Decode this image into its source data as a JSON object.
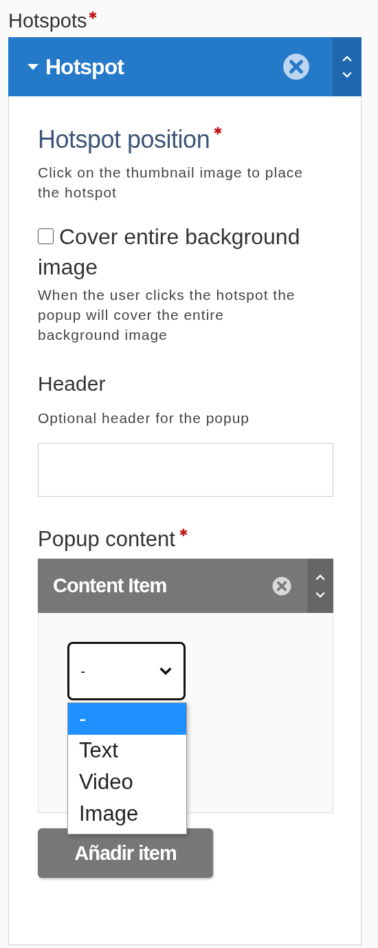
{
  "field_label": "Hotspots",
  "required": true,
  "group": {
    "title": "Hotspot",
    "expanded": true,
    "position": {
      "label": "Hotspot position",
      "required": true,
      "description": "Click on the thumbnail image to place the hotspot"
    },
    "cover": {
      "label": "Cover entire background image",
      "checked": false,
      "description": "When the user clicks the hotspot the popup will cover the entire background image"
    },
    "header": {
      "label": "Header",
      "description": "Optional header for the popup"
    },
    "popup": {
      "label": "Popup content",
      "required": true,
      "item": {
        "title": "Content Item",
        "select": {
          "value": "-",
          "open": true,
          "options": [
            {
              "label": "-",
              "selected": true
            },
            {
              "label": "Text",
              "selected": false
            },
            {
              "label": "Video",
              "selected": false
            },
            {
              "label": "Image",
              "selected": false
            }
          ]
        }
      },
      "add_button": "Añadir item"
    }
  }
}
